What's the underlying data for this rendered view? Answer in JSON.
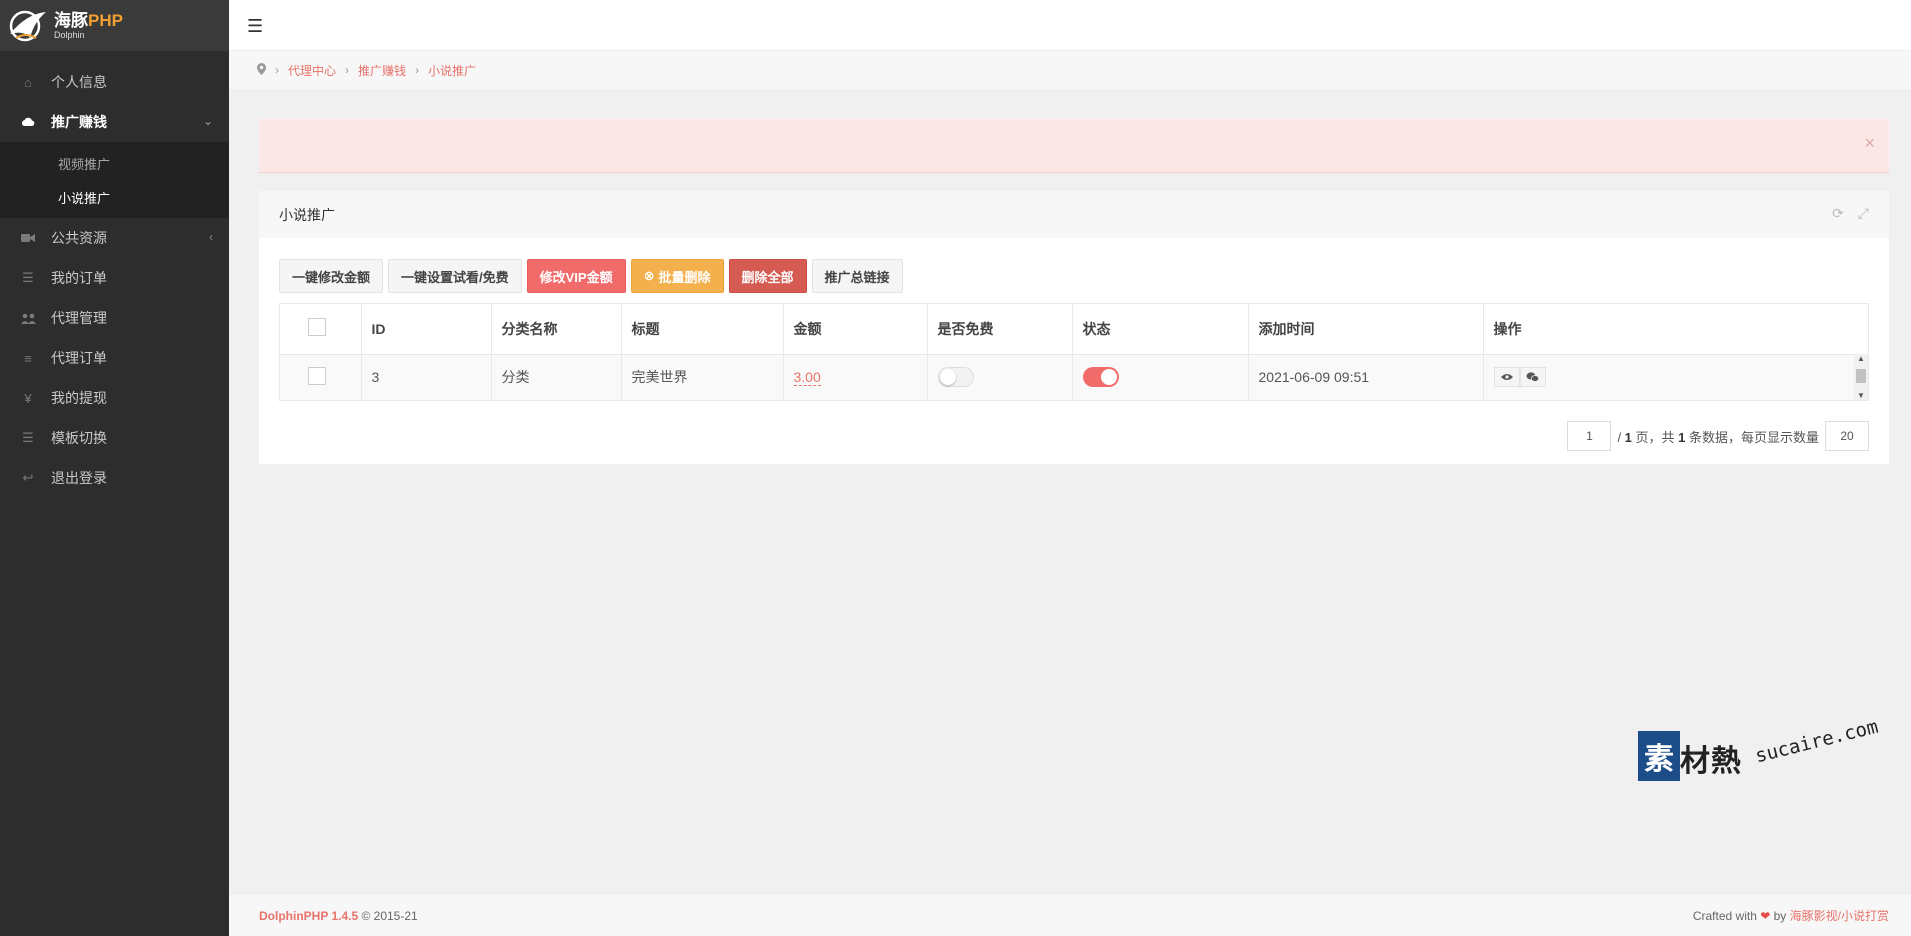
{
  "logo": {
    "title_cn": "海豚",
    "title_php": "PHP",
    "subtitle": "Dolphin"
  },
  "sidebar": {
    "items": [
      {
        "label": "个人信息",
        "icon": "home-icon"
      },
      {
        "label": "推广赚钱",
        "icon": "cloud-icon",
        "active": true,
        "children": [
          {
            "label": "视频推广"
          },
          {
            "label": "小说推广",
            "current": true
          }
        ]
      },
      {
        "label": "公共资源",
        "icon": "video-camera-icon"
      },
      {
        "label": "我的订单",
        "icon": "list-icon"
      },
      {
        "label": "代理管理",
        "icon": "users-icon"
      },
      {
        "label": "代理订单",
        "icon": "bars-icon"
      },
      {
        "label": "我的提现",
        "icon": "yen-icon"
      },
      {
        "label": "模板切换",
        "icon": "list-icon"
      },
      {
        "label": "退出登录",
        "icon": "reply-icon"
      }
    ]
  },
  "breadcrumb": {
    "items": [
      "代理中心",
      "推广赚钱",
      "小说推广"
    ]
  },
  "alert": {
    "close": "×"
  },
  "panel": {
    "title": "小说推广",
    "toolbar": {
      "edit_amount": "一键修改金额",
      "set_trial": "一键设置试看/免费",
      "edit_vip": "修改VIP金额",
      "batch_delete": "批量删除",
      "delete_all": "删除全部",
      "promo_link": "推广总链接"
    },
    "table": {
      "columns": [
        "ID",
        "分类名称",
        "标题",
        "金额",
        "是否免费",
        "状态",
        "添加时间",
        "操作"
      ],
      "rows": [
        {
          "id": "3",
          "category": "分类",
          "title": "完美世界",
          "amount": "3.00",
          "free": false,
          "status": true,
          "added": "2021-06-09 09:51"
        }
      ]
    },
    "pager": {
      "current_page": "1",
      "total_pages_label": "/ ",
      "total_pages": "1",
      "mid_label": " 页，共 ",
      "total_count": "1",
      "tail_label": " 条数据，每页显示数量",
      "per_page": "20"
    }
  },
  "watermark": {
    "box": "素",
    "cn": "材熱",
    "en": "sucaire.com"
  },
  "footer": {
    "brand": "DolphinPHP 1.4.5",
    "copyright": "© 2015-21",
    "crafted": "Crafted with",
    "by": "by",
    "link": "海豚影视/小说打赏"
  },
  "colors": {
    "accent": "#e8736b",
    "sidebar_bg": "#2d2d2d",
    "danger": "#f26b6b",
    "warning": "#f3b04c"
  }
}
